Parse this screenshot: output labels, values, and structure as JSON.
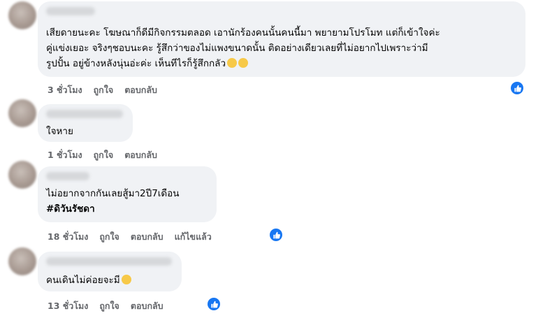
{
  "comments": [
    {
      "lines": [
        "เสียดายนะคะ โฆษณาก็ดีมีกิจกรรมตลอด เอานักร้องคนนั้นคนนี้มา พยายามโปรโมท แต่ก็เข้าใจค่ะ",
        "คู่แข่งเยอะ จริงๆชอบนะคะ รู้สึกว่าของไม่แพงขนาดนั้น ติดอย่างเดียวเลยที่ไม่อยากไปเพราะว่ามี",
        "รูปปั้น อยู่ข้างหลังนุ่นอ่ะค่ะ เห็นทีไรก็รู้สึกกลัว"
      ],
      "time": "3 ชั่วโมง",
      "like": "ถูกใจ",
      "reply": "ตอบกลับ"
    },
    {
      "lines": [
        "ใจหาย"
      ],
      "time": "1 ชั่วโมง",
      "like": "ถูกใจ",
      "reply": "ตอบกลับ"
    },
    {
      "lines": [
        "ไม่อยากจากกันเลยสู้มา2ปี7เดือน"
      ],
      "hashtag": "#ดิวันรัชดา",
      "time": "18 ชั่วโมง",
      "like": "ถูกใจ",
      "reply": "ตอบกลับ",
      "edited": "แก้ไขแล้ว"
    },
    {
      "lines": [
        "คนเดินไม่ค่อยจะมี"
      ],
      "time": "13 ชั่วโมง",
      "like": "ถูกใจ",
      "reply": "ตอบกลับ"
    }
  ],
  "colors": {
    "bubble": "#f0f2f5",
    "meta": "#65676b",
    "accent": "#1877f2"
  }
}
